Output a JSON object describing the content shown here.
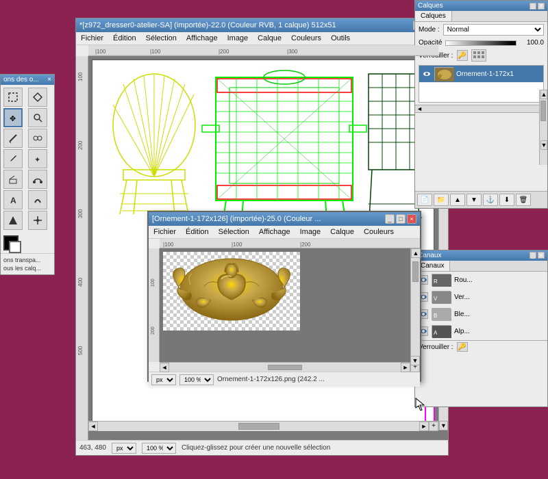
{
  "app": {
    "bg_color": "#8B2252"
  },
  "main_window": {
    "title": "*[z972_dresser0-atelier-SA] (importée)-22.0 (Couleur RVB, 1 calque) 512x51",
    "menus": [
      "Fichier",
      "Édition",
      "Sélection",
      "Affichage",
      "Image",
      "Calque",
      "Couleurs",
      "Outils"
    ],
    "status": {
      "coords": "463, 480",
      "unit": "px",
      "zoom": "100 %",
      "hint": "Cliquez-glissez pour créer une nouvelle sélection"
    }
  },
  "toolbox": {
    "title": "ons des o...",
    "tools": [
      "✏️",
      "🔲",
      "⬡",
      "🔍",
      "🖊",
      "✂",
      "🖌",
      "🎨",
      "📐",
      "🔧",
      "🖱",
      "💧",
      "⭐",
      "✦"
    ]
  },
  "layers_panel": {
    "title": "Calques",
    "tab": "Calques",
    "mode_label": "Mode :",
    "mode_value": "Normal",
    "opacity_label": "Opacité",
    "opacity_value": "100.0",
    "lock_label": "Verrouiller :",
    "layer_name": "Ornement-1-172x1",
    "toolbar_buttons": [
      "📄",
      "📁",
      "⬆",
      "⬇",
      "⬆",
      "⬇",
      "🗑"
    ]
  },
  "channels_panel": {
    "title": "Canaux",
    "tab": "Canaux",
    "lock_label": "Verrouiller :",
    "channels": [
      {
        "name": "Rou...",
        "color": "#FF4444"
      },
      {
        "name": "Ver...",
        "color": "#44AA44"
      },
      {
        "name": "Ble...",
        "color": "#4444FF"
      },
      {
        "name": "Alp...",
        "color": "#888888"
      }
    ]
  },
  "ornament_window": {
    "title": "[Ornement-1-172x126] (importée)-25.0 (Couleur ... ",
    "menus": [
      "Fichier",
      "Édition",
      "Sélection",
      "Affichage",
      "Image",
      "Calque",
      "Couleurs"
    ],
    "statusbar": {
      "unit": "px",
      "zoom": "100 %",
      "filename": "Ornement-1-172x126.png (242.2 ..."
    },
    "rulers": {
      "h_marks": "100 | 100 | 200",
      "v_marks": "100 | 200"
    }
  }
}
